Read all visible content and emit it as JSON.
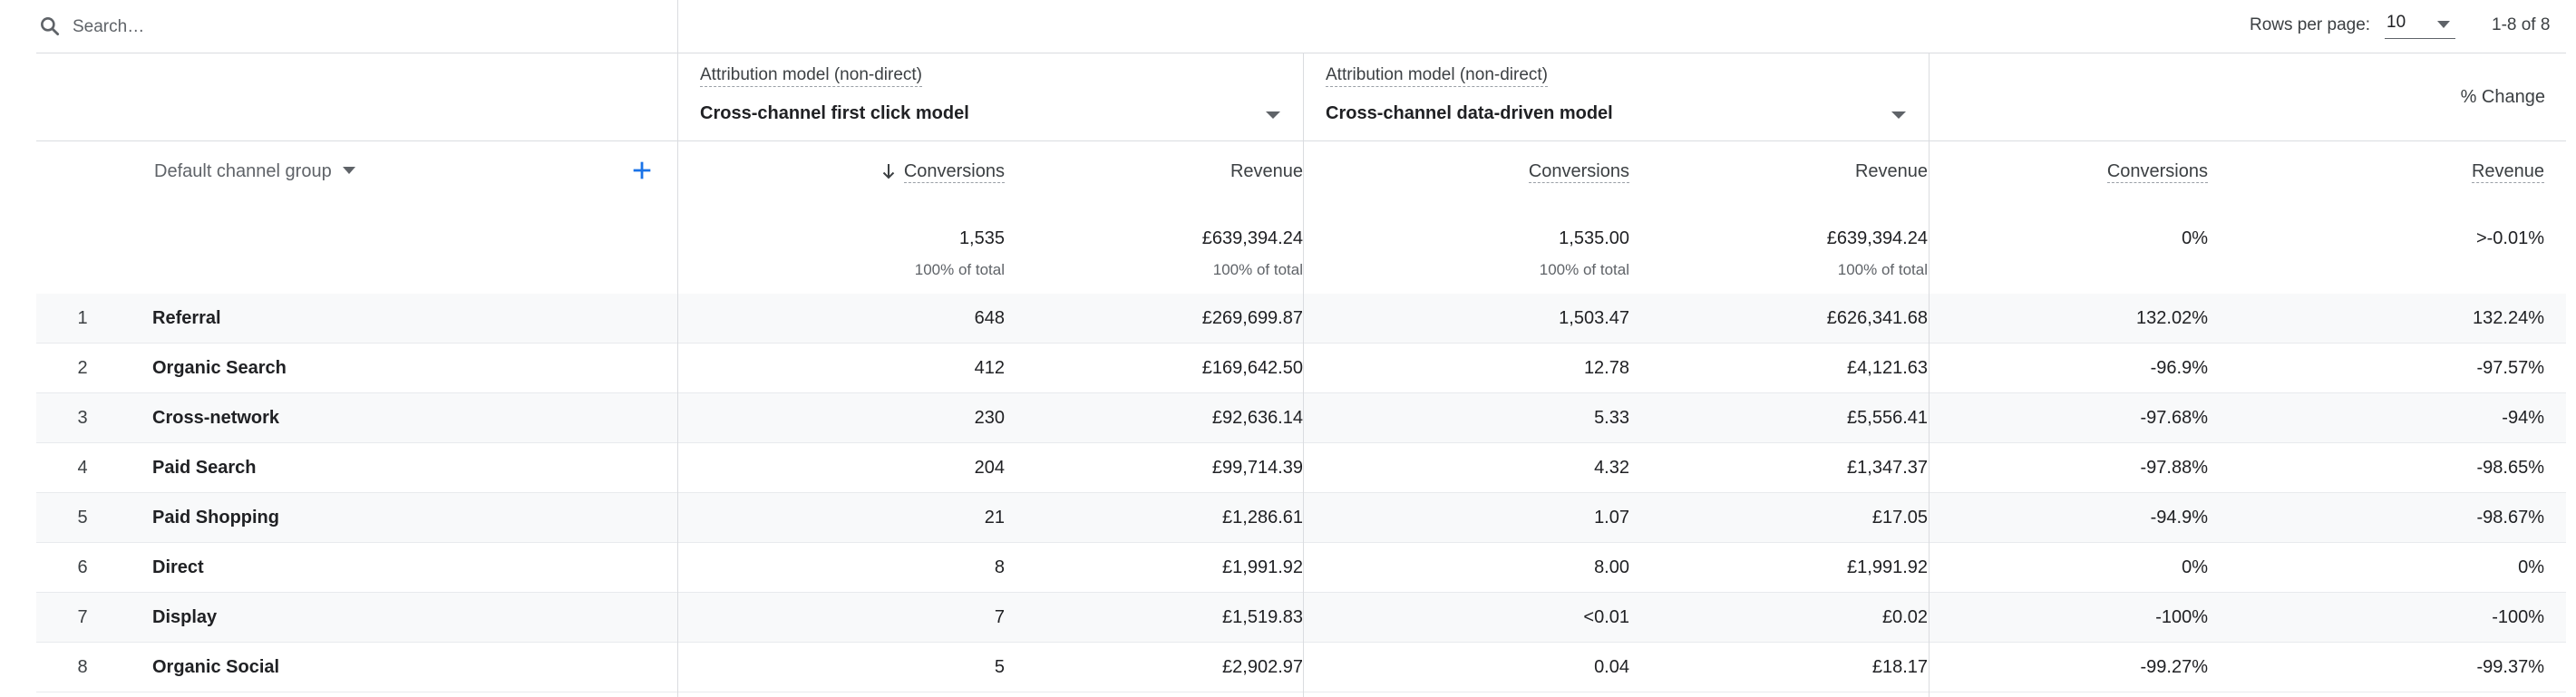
{
  "toolbar": {
    "search_placeholder": "Search…",
    "rows_per_page_label": "Rows per page:",
    "rows_per_page_value": "10",
    "page_range": "1-8 of 8"
  },
  "header": {
    "model_caption_1": "Attribution model (non-direct)",
    "model_value_1": "Cross-channel first click model",
    "model_caption_2": "Attribution model (non-direct)",
    "model_value_2": "Cross-channel data-driven model",
    "change_label": "% Change",
    "dimension_label": "Default channel group",
    "col_conversions": "Conversions",
    "col_revenue": "Revenue"
  },
  "totals": {
    "conv_1": "1,535",
    "conv_1_sub": "100% of total",
    "rev_1": "£639,394.24",
    "rev_1_sub": "100% of total",
    "conv_2": "1,535.00",
    "conv_2_sub": "100% of total",
    "rev_2": "£639,394.24",
    "rev_2_sub": "100% of total",
    "conv_change": "0%",
    "rev_change": ">-0.01%"
  },
  "rows": [
    {
      "idx": "1",
      "name": "Referral",
      "conv_1": "648",
      "rev_1": "£269,699.87",
      "conv_2": "1,503.47",
      "rev_2": "£626,341.68",
      "conv_change": "132.02%",
      "rev_change": "132.24%"
    },
    {
      "idx": "2",
      "name": "Organic Search",
      "conv_1": "412",
      "rev_1": "£169,642.50",
      "conv_2": "12.78",
      "rev_2": "£4,121.63",
      "conv_change": "-96.9%",
      "rev_change": "-97.57%"
    },
    {
      "idx": "3",
      "name": "Cross-network",
      "conv_1": "230",
      "rev_1": "£92,636.14",
      "conv_2": "5.33",
      "rev_2": "£5,556.41",
      "conv_change": "-97.68%",
      "rev_change": "-94%"
    },
    {
      "idx": "4",
      "name": "Paid Search",
      "conv_1": "204",
      "rev_1": "£99,714.39",
      "conv_2": "4.32",
      "rev_2": "£1,347.37",
      "conv_change": "-97.88%",
      "rev_change": "-98.65%"
    },
    {
      "idx": "5",
      "name": "Paid Shopping",
      "conv_1": "21",
      "rev_1": "£1,286.61",
      "conv_2": "1.07",
      "rev_2": "£17.05",
      "conv_change": "-94.9%",
      "rev_change": "-98.67%"
    },
    {
      "idx": "6",
      "name": "Direct",
      "conv_1": "8",
      "rev_1": "£1,991.92",
      "conv_2": "8.00",
      "rev_2": "£1,991.92",
      "conv_change": "0%",
      "rev_change": "0%"
    },
    {
      "idx": "7",
      "name": "Display",
      "conv_1": "7",
      "rev_1": "£1,519.83",
      "conv_2": "<0.01",
      "rev_2": "£0.02",
      "conv_change": "-100%",
      "rev_change": "-100%"
    },
    {
      "idx": "8",
      "name": "Organic Social",
      "conv_1": "5",
      "rev_1": "£2,902.97",
      "conv_2": "0.04",
      "rev_2": "£18.17",
      "conv_change": "-99.27%",
      "rev_change": "-99.37%"
    }
  ],
  "icons": {
    "search": "search-icon",
    "add": "plus-icon",
    "sort": "arrow-down-icon",
    "caret": "caret-down-icon"
  },
  "colors": {
    "accent": "#1a73e8",
    "border": "#dadce0",
    "row_alt": "#f8f9fa"
  }
}
